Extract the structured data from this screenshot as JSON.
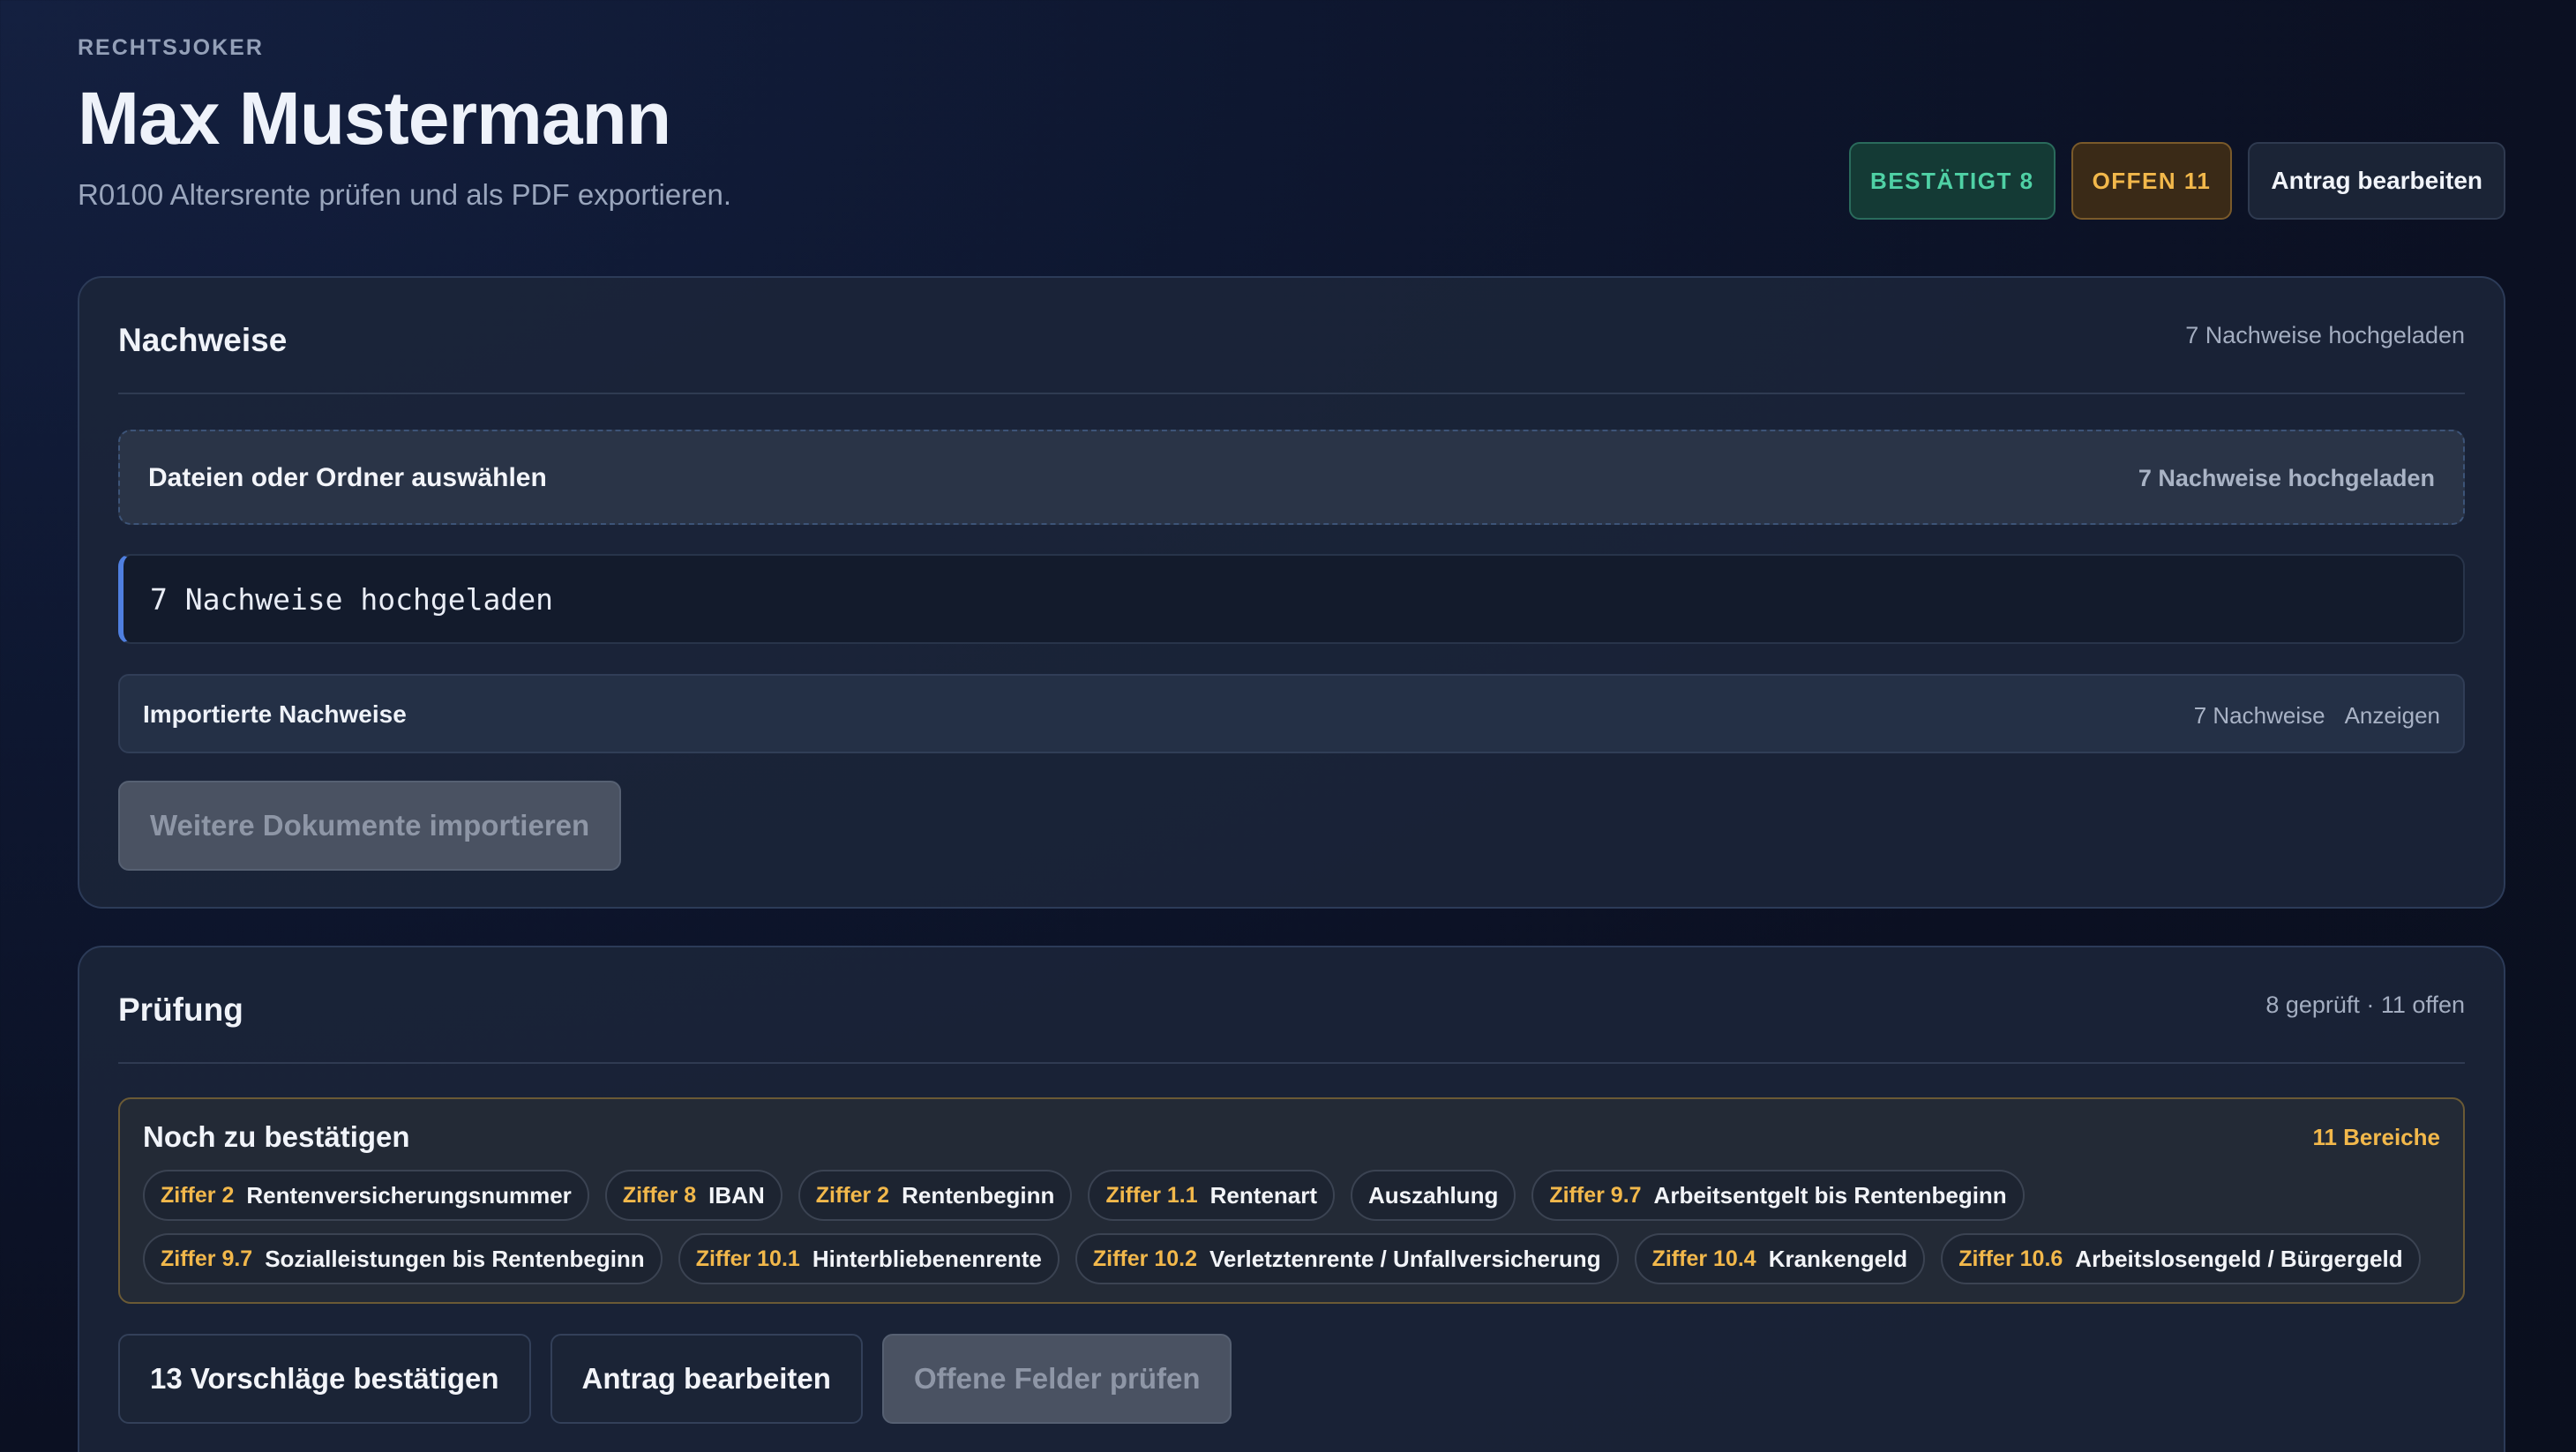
{
  "header": {
    "eyebrow": "RECHTSJOKER",
    "title": "Max Mustermann",
    "subtitle": "R0100 Altersrente prüfen und als PDF exportieren.",
    "confirmed_badge": "BESTÄTIGT 8",
    "open_badge": "OFFEN 11",
    "edit_button": "Antrag bearbeiten"
  },
  "nachweise": {
    "title": "Nachweise",
    "meta": "7 Nachweise hochgeladen",
    "dropzone_label": "Dateien oder Ordner auswählen",
    "dropzone_count": "7 Nachweise hochgeladen",
    "status_text": "7 Nachweise hochgeladen",
    "imported_label": "Importierte Nachweise",
    "imported_count": "7 Nachweise",
    "imported_toggle": "Anzeigen",
    "import_more_button": "Weitere Dokumente importieren"
  },
  "pruefung": {
    "title": "Prüfung",
    "meta": "8 geprüft · 11 offen",
    "pending_title": "Noch zu bestätigen",
    "pending_count": "11 Bereiche",
    "chips": [
      {
        "ziffer": "Ziffer 2",
        "name": "Rentenversicherungsnummer"
      },
      {
        "ziffer": "Ziffer 8",
        "name": "IBAN"
      },
      {
        "ziffer": "Ziffer 2",
        "name": "Rentenbeginn"
      },
      {
        "ziffer": "Ziffer 1.1",
        "name": "Rentenart"
      },
      {
        "ziffer": "",
        "name": "Auszahlung"
      },
      {
        "ziffer": "Ziffer 9.7",
        "name": "Arbeitsentgelt bis Rentenbeginn"
      },
      {
        "ziffer": "Ziffer 9.7",
        "name": "Sozialleistungen bis Rentenbeginn"
      },
      {
        "ziffer": "Ziffer 10.1",
        "name": "Hinterbliebenenrente"
      },
      {
        "ziffer": "Ziffer 10.2",
        "name": "Verletztenrente / Unfallversicherung"
      },
      {
        "ziffer": "Ziffer 10.4",
        "name": "Krankengeld"
      },
      {
        "ziffer": "Ziffer 10.6",
        "name": "Arbeitslosengeld / Bürgergeld"
      }
    ],
    "confirm_button": "13 Vorschläge bestätigen",
    "edit_button": "Antrag bearbeiten",
    "check_button": "Offene Felder prüfen"
  }
}
